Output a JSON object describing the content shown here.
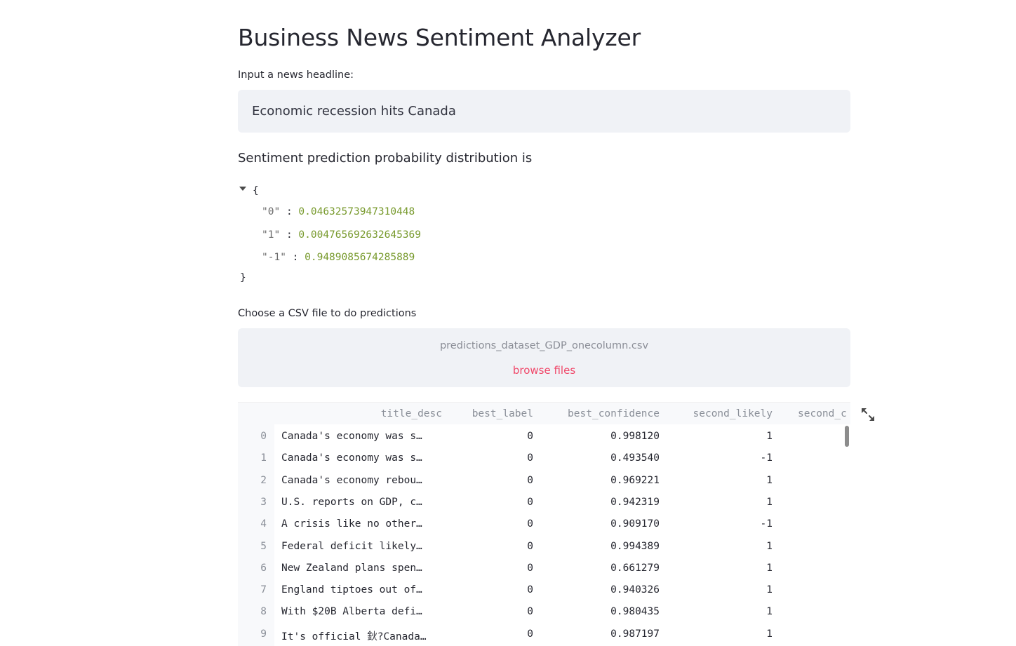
{
  "page": {
    "title": "Business News Sentiment Analyzer"
  },
  "headline_input": {
    "label": "Input a news headline:",
    "value": "Economic recession hits Canada"
  },
  "prediction": {
    "heading": "Sentiment prediction probability distribution is",
    "open_brace": "{",
    "close_brace": "}",
    "entries": [
      {
        "key": "\"0\"",
        "value": "0.04632573947310448"
      },
      {
        "key": "\"1\"",
        "value": "0.004765692632645369"
      },
      {
        "key": "\"-1\"",
        "value": "0.9489085674285889"
      }
    ]
  },
  "uploader": {
    "label": "Choose a CSV file to do predictions",
    "file_name": "predictions_dataset_GDP_onecolumn.csv",
    "browse_label": "browse files"
  },
  "table": {
    "columns": [
      "title_desc",
      "best_label",
      "best_confidence",
      "second_likely",
      "second_c"
    ],
    "rows": [
      {
        "index": "0",
        "title_desc": "Canada's economy was s…",
        "best_label": "0",
        "best_confidence": "0.998120",
        "second_likely": "1"
      },
      {
        "index": "1",
        "title_desc": "Canada's economy was s…",
        "best_label": "0",
        "best_confidence": "0.493540",
        "second_likely": "-1"
      },
      {
        "index": "2",
        "title_desc": "Canada's economy rebou…",
        "best_label": "0",
        "best_confidence": "0.969221",
        "second_likely": "1"
      },
      {
        "index": "3",
        "title_desc": "U.S. reports on GDP, c…",
        "best_label": "0",
        "best_confidence": "0.942319",
        "second_likely": "1"
      },
      {
        "index": "4",
        "title_desc": "A crisis like no other…",
        "best_label": "0",
        "best_confidence": "0.909170",
        "second_likely": "-1"
      },
      {
        "index": "5",
        "title_desc": "Federal deficit likely…",
        "best_label": "0",
        "best_confidence": "0.994389",
        "second_likely": "1"
      },
      {
        "index": "6",
        "title_desc": "New Zealand plans spen…",
        "best_label": "0",
        "best_confidence": "0.661279",
        "second_likely": "1"
      },
      {
        "index": "7",
        "title_desc": "England tiptoes out of…",
        "best_label": "0",
        "best_confidence": "0.940326",
        "second_likely": "1"
      },
      {
        "index": "8",
        "title_desc": "With $20B Alberta defi…",
        "best_label": "0",
        "best_confidence": "0.980435",
        "second_likely": "1"
      },
      {
        "index": "9",
        "title_desc": "It's official 鈥?Canada…",
        "best_label": "0",
        "best_confidence": "0.987197",
        "second_likely": "1"
      }
    ]
  },
  "icons": {
    "expand": "expand-arrows-icon",
    "toggle": "caret-down-icon"
  },
  "colors": {
    "accent": "#f0486a",
    "json_value": "#789a2d",
    "input_bg": "#f0f2f6"
  }
}
